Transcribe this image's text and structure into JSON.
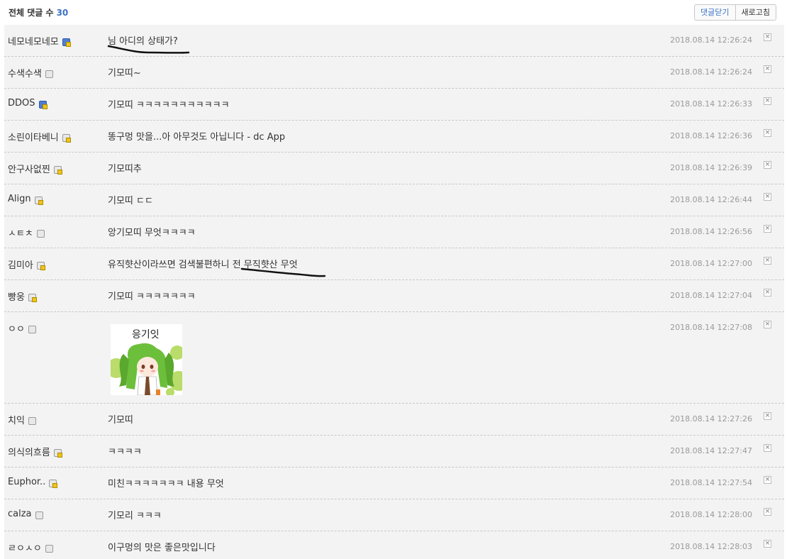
{
  "header": {
    "title": "전체 댓글 수",
    "count": "30",
    "close_comments_label": "댓글닫기",
    "refresh_label": "새로고침"
  },
  "comments": [
    {
      "nick": "네모네모네모",
      "icon": "blue",
      "text": "님 아디의 상태가?",
      "date": "2018.08.14 12:26:24"
    },
    {
      "nick": "수색수색",
      "icon": "gray",
      "text": "기모띠~",
      "date": "2018.08.14 12:26:24"
    },
    {
      "nick": "DDOS",
      "icon": "blue",
      "text": "기모띠 ㅋㅋㅋㅋㅋㅋㅋㅋㅋㅋㅋ",
      "date": "2018.08.14 12:26:33"
    },
    {
      "nick": "소린이타베니",
      "icon": "yellow",
      "text": "똥구멍 맛을...아 아무것도 아닙니다 - dc App",
      "date": "2018.08.14 12:26:36"
    },
    {
      "nick": "안구사없찐",
      "icon": "yellow",
      "text": "기모띠추",
      "date": "2018.08.14 12:26:39"
    },
    {
      "nick": "Align",
      "icon": "yellow",
      "text": "기모띠 ㄷㄷ",
      "date": "2018.08.14 12:26:44"
    },
    {
      "nick": "ㅅㅌㅊ",
      "icon": "gray",
      "text": "앙기모띠 무엇ㅋㅋㅋㅋ",
      "date": "2018.08.14 12:26:56"
    },
    {
      "nick": "김미아",
      "icon": "yellow",
      "text": "유직햣산이라쓰면 검색불편하니 전 무직햣산 무엇",
      "date": "2018.08.14 12:27:00"
    },
    {
      "nick": "빵웅",
      "icon": "yellow",
      "text": "기모띠 ㅋㅋㅋㅋㅋㅋㅋ",
      "date": "2018.08.14 12:27:04"
    },
    {
      "nick": "ㅇㅇ",
      "icon": "gray",
      "text": "",
      "date": "2018.08.14 12:27:08",
      "sticker_text": "응기잇"
    },
    {
      "nick": "치익",
      "icon": "gray",
      "text": "기모띠",
      "date": "2018.08.14 12:27:26"
    },
    {
      "nick": "의식의흐름",
      "icon": "yellow",
      "text": "ㅋㅋㅋㅋ",
      "date": "2018.08.14 12:27:47"
    },
    {
      "nick": "Euphor..",
      "icon": "yellow",
      "text": "미친ㅋㅋㅋㅋㅋㅋㅋ 내용 무엇",
      "date": "2018.08.14 12:27:54"
    },
    {
      "nick": "calza",
      "icon": "gray",
      "text": "기모리 ㅋㅋㅋ",
      "date": "2018.08.14 12:28:00"
    },
    {
      "nick": "ㄹㅇㅅㅇ",
      "icon": "gray",
      "text": "이구멍의 맛은 좋은맛입니다",
      "date": "2018.08.14 12:28:03"
    }
  ],
  "delete_glyph": "×",
  "colors": {
    "accent": "#3b72c8",
    "row_bg": "#f3f3f3",
    "date": "#9a9a9a"
  }
}
